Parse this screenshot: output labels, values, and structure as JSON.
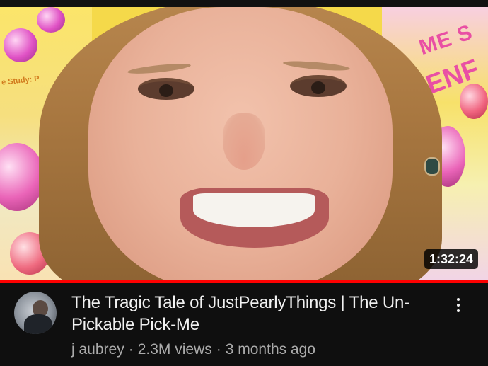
{
  "video": {
    "duration": "1:32:24",
    "title": "The Tragic Tale of JustPearlyThings | The Un-Pickable Pick-Me",
    "channel": "j aubrey",
    "views": "2.3M views",
    "age": "3 months ago",
    "separator": "·",
    "watched_fraction": 1.0
  },
  "thumbnail": {
    "left_text": "e Study: P",
    "right_text_1": "ME S",
    "right_text_2": "ENF"
  },
  "icons": {
    "menu": "more-vert-icon",
    "avatar": "channel-avatar"
  },
  "colors": {
    "background": "#0f0f0f",
    "progress": "#ff0000",
    "title": "#f1f1f1",
    "meta": "#aaaaaa"
  }
}
